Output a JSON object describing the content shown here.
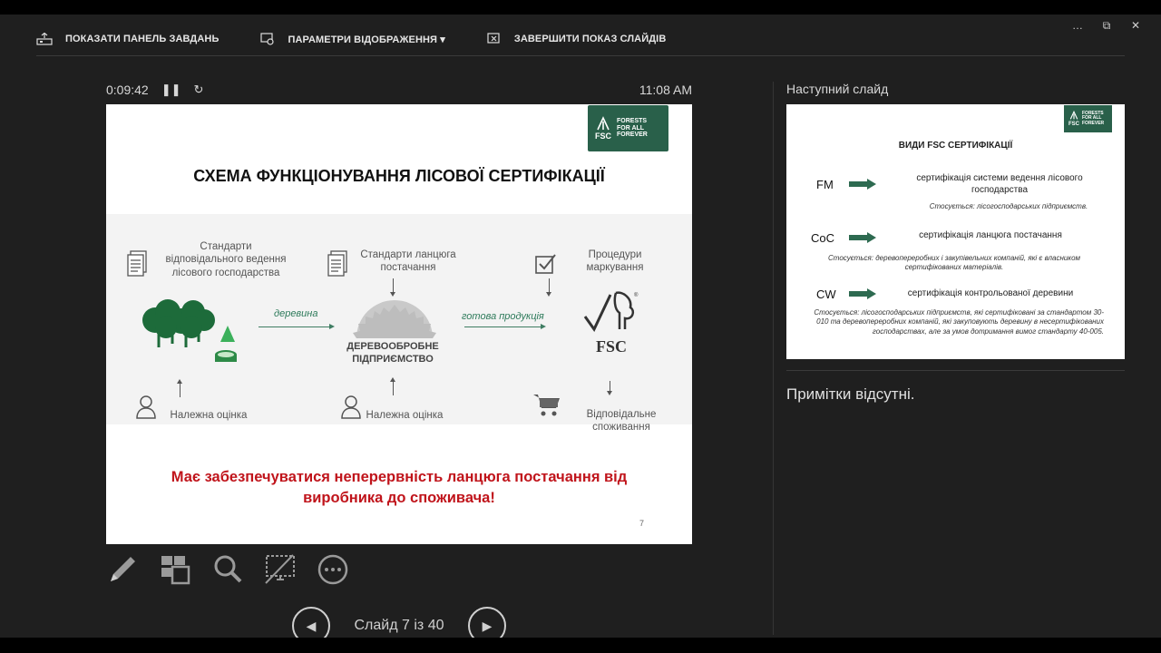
{
  "window": {
    "controls": [
      "…",
      "⧉",
      "✕"
    ]
  },
  "toolbar": {
    "show_taskbar": "ПОКАЗАТИ ПАНЕЛЬ ЗАВДАНЬ",
    "display_settings": "ПАРАМЕТРИ ВІДОБРАЖЕННЯ ▾",
    "end_show": "ЗАВЕРШИТИ ПОКАЗ СЛАЙДІВ"
  },
  "timer": {
    "elapsed": "0:09:42",
    "pause_icon": "pause-icon",
    "reset_icon": "reset-icon",
    "clock": "11:08 AM"
  },
  "slide": {
    "logo": {
      "mark": "FSC",
      "words": [
        "FORESTS",
        "FOR ALL",
        "FOREVER"
      ]
    },
    "title": "СХЕМА ФУНКЦІОНУВАННЯ ЛІСОВОЇ СЕРТИФІКАЦІЇ",
    "col1_standards": "Стандарти відповідального ведення лісового господарства",
    "col2_standards": "Стандарти ланцюга постачання",
    "col3_procedures": "Процедури маркування",
    "arrow1": "деревина",
    "arrow2": "готова продукція",
    "enterprise": "ДЕРЕВООБРОБНЕ ПІДПРИЄМСТВО",
    "fsc_label": "FSC",
    "eval1": "Належна оцінка",
    "eval2": "Належна оцінка",
    "consumption": "Відповідальне споживання",
    "red_line1": "Має забезпечуватися неперервність ланцюга постачання від",
    "red_line2": "виробника до споживача!",
    "number": "7"
  },
  "tools": [
    "pen-icon",
    "slides-grid-icon",
    "zoom-icon",
    "black-screen-icon",
    "more-icon"
  ],
  "nav": {
    "label": "Слайд 7 із 40",
    "prev": "◀",
    "next": "▶"
  },
  "next_slide": {
    "heading": "Наступний слайд",
    "title": "ВИДИ FSC СЕРТИФІКАЦІЇ",
    "fm": "FM",
    "fm_text": "сертифікація системи ведення лісового господарства",
    "fm_note": "Стосується: лісогосподарських підприємств.",
    "coc": "CoC",
    "coc_text": "сертифікація ланцюга постачання",
    "coc_note": "Стосується: деревопереробних і закупівельних компаній, які є власником сертифікованих матеріалів.",
    "cw": "CW",
    "cw_text": "сертифікація контрольованої деревини",
    "cw_note": "Стосується: лісогосподарських підприємств, які сертифіковані за стандартом 30-010 та деревопереробних компаній, які закуповують деревину в несертифікованих господарствах, але за умов дотримання вимог стандарту 40-005."
  },
  "notes": "Примітки відсутні.",
  "colors": {
    "fsc_green": "#29604a",
    "accent_red": "#c0141b",
    "bg": "#1f1f1f"
  }
}
